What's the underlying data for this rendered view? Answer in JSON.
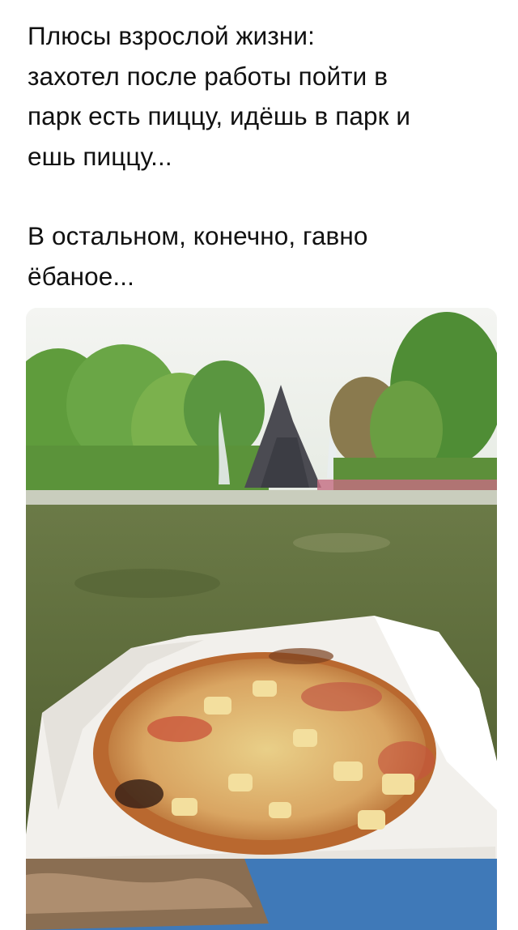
{
  "post": {
    "paragraphs": [
      {
        "lines": [
          "Плюсы взрослой жизни:",
          "захотел после работы пойти в",
          "парк есть пиццу, идёшь в парк и",
          "ешь пиццу..."
        ]
      },
      {
        "lines": [
          "В остальном, конечно, гавно",
          "ёбаное..."
        ]
      }
    ]
  },
  "photo": {
    "subject": "pizza-in-park",
    "colors": {
      "sky": "#f1f3ef",
      "trees": "#5b9b3a",
      "grass": "#5e6a3d",
      "fountain_rock": "#4a4a4e",
      "box": "#f4f2ee",
      "box_blue": "#3f79b8",
      "crust": "#c27a3e",
      "cheese": "#efd99a"
    }
  }
}
